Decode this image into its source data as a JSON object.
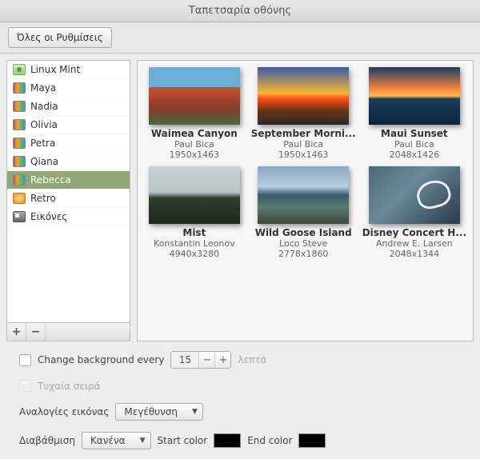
{
  "window": {
    "title": "Ταπετσαρία οθόνης"
  },
  "toolbar": {
    "back_label": "Όλες οι Ρυθμίσεις"
  },
  "sidebar": {
    "items": [
      {
        "label": "Linux Mint",
        "icon": "mint",
        "selected": false
      },
      {
        "label": "Maya",
        "icon": "gradient",
        "selected": false
      },
      {
        "label": "Nadia",
        "icon": "gradient",
        "selected": false
      },
      {
        "label": "Olivia",
        "icon": "gradient",
        "selected": false
      },
      {
        "label": "Petra",
        "icon": "gradient",
        "selected": false
      },
      {
        "label": "Qiana",
        "icon": "gradient",
        "selected": false
      },
      {
        "label": "Rebecca",
        "icon": "gradient",
        "selected": true
      },
      {
        "label": "Retro",
        "icon": "retro",
        "selected": false
      },
      {
        "label": "Εικόνες",
        "icon": "images",
        "selected": false
      }
    ],
    "add_tooltip": "+",
    "remove_tooltip": "−"
  },
  "wallpapers": [
    {
      "title": "Waimea Canyon",
      "author": "Paul Bica",
      "resolution": "1950x1463"
    },
    {
      "title": "September Morni...",
      "author": "Paul Bica",
      "resolution": "1950x1463"
    },
    {
      "title": "Maui Sunset",
      "author": "Paul Bica",
      "resolution": "2048x1426"
    },
    {
      "title": "Mist",
      "author": "Konstantin Leonov",
      "resolution": "4940x3280"
    },
    {
      "title": "Wild Goose Island",
      "author": "Loco Steve",
      "resolution": "2778x1860"
    },
    {
      "title": "Disney Concert H...",
      "author": "Andrew E. Larsen",
      "resolution": "2048x1344"
    }
  ],
  "settings": {
    "change_every_label": "Change background every",
    "change_every_value": "15",
    "change_every_unit": "λεπτά",
    "random_order_label": "Τυχαία σειρά",
    "aspect_label": "Αναλογίες εικόνας",
    "aspect_value": "Μεγέθυνση",
    "gradient_label": "Διαβάθμιση",
    "gradient_value": "Κανένα",
    "start_color_label": "Start color",
    "end_color_label": "End color",
    "start_color": "#000000",
    "end_color": "#000000"
  }
}
